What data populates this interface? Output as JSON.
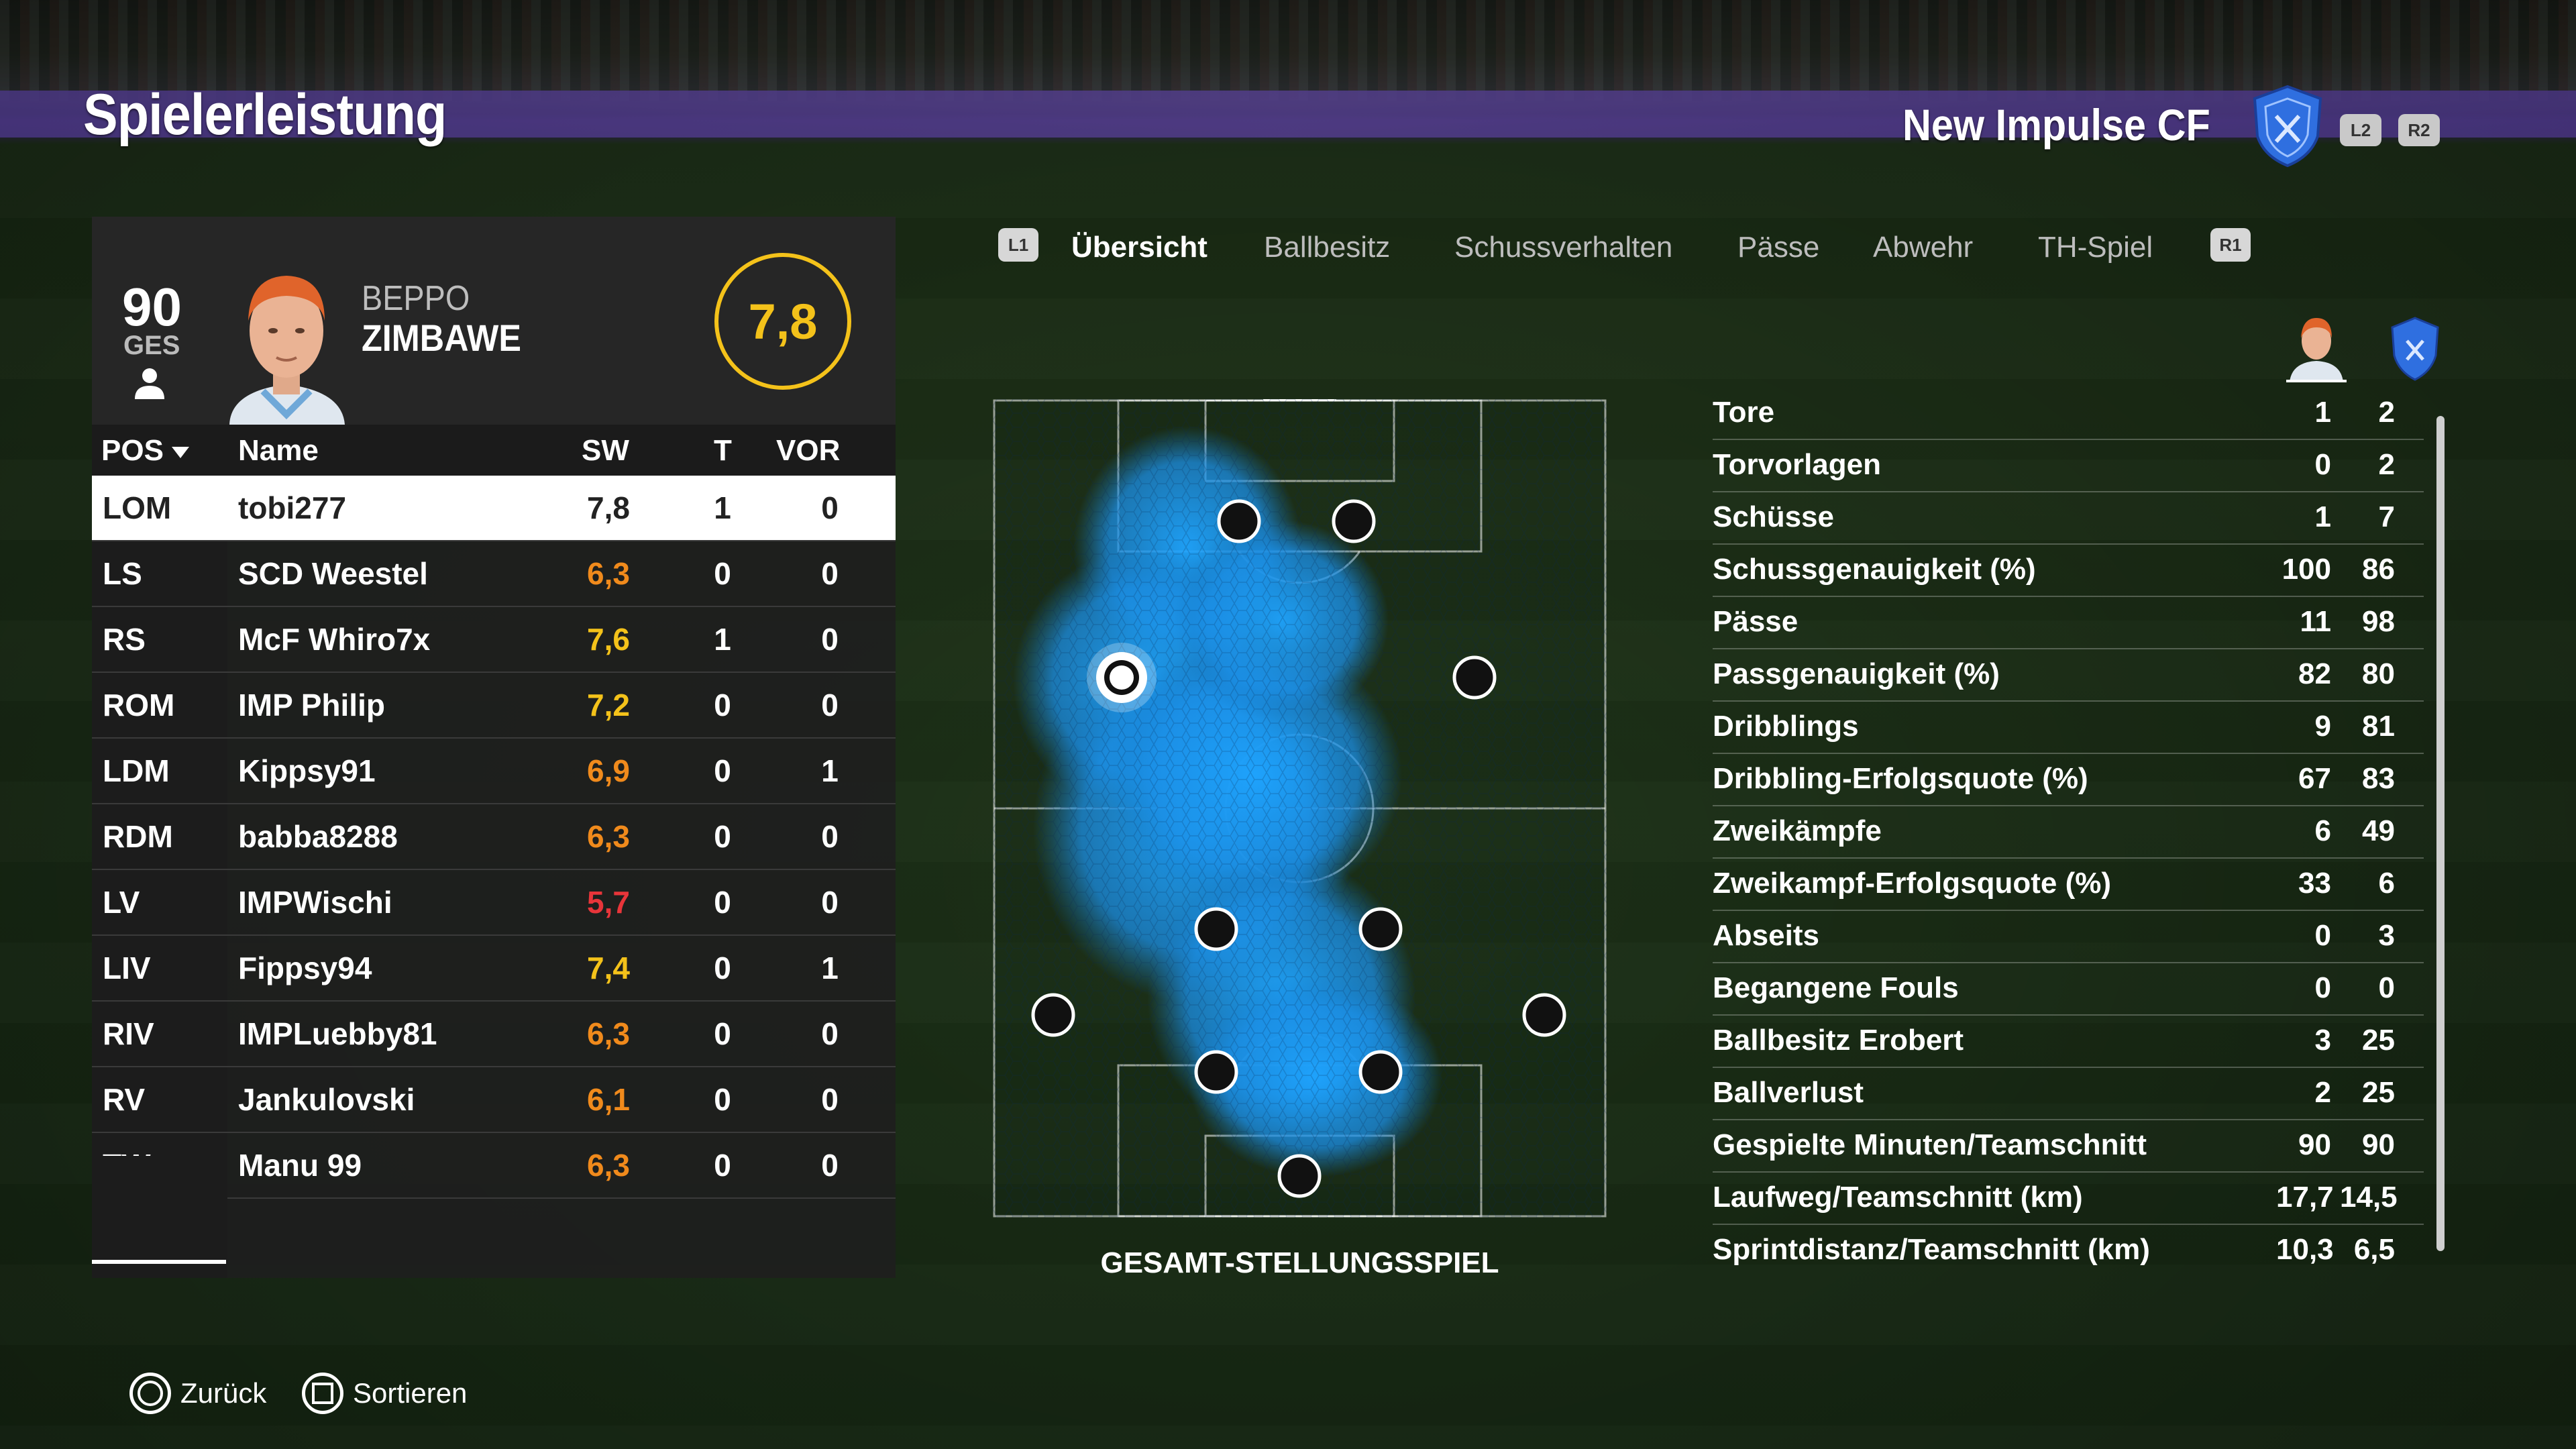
{
  "header": {
    "title": "Spielerleistung",
    "team_name": "New Impulse CF",
    "l2": "L2",
    "r2": "R2"
  },
  "player": {
    "overall": "90",
    "overall_label": "GES",
    "first_name": "BEPPO",
    "last_name": "ZIMBAWE",
    "match_rating": "7,8"
  },
  "table": {
    "headers": {
      "pos": "POS",
      "name": "Name",
      "sw": "SW",
      "t": "T",
      "vor": "VOR"
    },
    "rows": [
      {
        "pos": "LOM",
        "name": "tobi277",
        "sw": "7,8",
        "t": "1",
        "vor": "0",
        "sw_color": "#222222"
      },
      {
        "pos": "LS",
        "name": "SCD Weestel",
        "sw": "6,3",
        "t": "0",
        "vor": "0",
        "sw_color": "#f08a1c"
      },
      {
        "pos": "RS",
        "name": "McF Whiro7x",
        "sw": "7,6",
        "t": "1",
        "vor": "0",
        "sw_color": "#f4c21a"
      },
      {
        "pos": "ROM",
        "name": "IMP Philip",
        "sw": "7,2",
        "t": "0",
        "vor": "0",
        "sw_color": "#f4c21a"
      },
      {
        "pos": "LDM",
        "name": "Kippsy91",
        "sw": "6,9",
        "t": "0",
        "vor": "1",
        "sw_color": "#f08a1c"
      },
      {
        "pos": "RDM",
        "name": "babba8288",
        "sw": "6,3",
        "t": "0",
        "vor": "0",
        "sw_color": "#f08a1c"
      },
      {
        "pos": "LV",
        "name": "IMPWischi",
        "sw": "5,7",
        "t": "0",
        "vor": "0",
        "sw_color": "#e8353a"
      },
      {
        "pos": "LIV",
        "name": "Fippsy94",
        "sw": "7,4",
        "t": "0",
        "vor": "1",
        "sw_color": "#f4c21a"
      },
      {
        "pos": "RIV",
        "name": "IMPLuebby81",
        "sw": "6,3",
        "t": "0",
        "vor": "0",
        "sw_color": "#f08a1c"
      },
      {
        "pos": "RV",
        "name": "Jankulovski",
        "sw": "6,1",
        "t": "0",
        "vor": "0",
        "sw_color": "#f08a1c"
      },
      {
        "pos": "TW",
        "name": "Manu 99",
        "sw": "6,3",
        "t": "0",
        "vor": "0",
        "sw_color": "#f08a1c"
      }
    ]
  },
  "tabs": {
    "l1": "L1",
    "r1": "R1",
    "items": [
      "Übersicht",
      "Ballbesitz",
      "Schussverhalten",
      "Pässe",
      "Abwehr",
      "TH-Spiel"
    ]
  },
  "pitch": {
    "caption": "GESAMT-STELLUNGSSPIEL"
  },
  "stats": [
    {
      "label": "Tore",
      "player": "1",
      "team": "2"
    },
    {
      "label": "Torvorlagen",
      "player": "0",
      "team": "2"
    },
    {
      "label": "Schüsse",
      "player": "1",
      "team": "7"
    },
    {
      "label": "Schussgenauigkeit (%)",
      "player": "100",
      "team": "86"
    },
    {
      "label": "Pässe",
      "player": "11",
      "team": "98"
    },
    {
      "label": "Passgenauigkeit (%)",
      "player": "82",
      "team": "80"
    },
    {
      "label": "Dribblings",
      "player": "9",
      "team": "81"
    },
    {
      "label": "Dribbling-Erfolgsquote (%)",
      "player": "67",
      "team": "83"
    },
    {
      "label": "Zweikämpfe",
      "player": "6",
      "team": "49"
    },
    {
      "label": "Zweikampf-Erfolgsquote (%)",
      "player": "33",
      "team": "6"
    },
    {
      "label": "Abseits",
      "player": "0",
      "team": "3"
    },
    {
      "label": "Begangene Fouls",
      "player": "0",
      "team": "0"
    },
    {
      "label": "Ballbesitz Erobert",
      "player": "3",
      "team": "25"
    },
    {
      "label": "Ballverlust",
      "player": "2",
      "team": "25"
    },
    {
      "label": "Gespielte Minuten/Teamschnitt",
      "player": "90",
      "team": "90"
    },
    {
      "label": "Laufweg/Teamschnitt (km)",
      "player": "17,7",
      "team": "14,5"
    },
    {
      "label": "Sprintdistanz/Teamschnitt (km)",
      "player": "10,3",
      "team": "6,5"
    }
  ],
  "footer": {
    "back_label": "Zurück",
    "sort_label": "Sortieren"
  },
  "colors": {
    "accent": "#f4c21a",
    "heatmap": "#2aa6ff",
    "crest": "#2f6fe0"
  }
}
